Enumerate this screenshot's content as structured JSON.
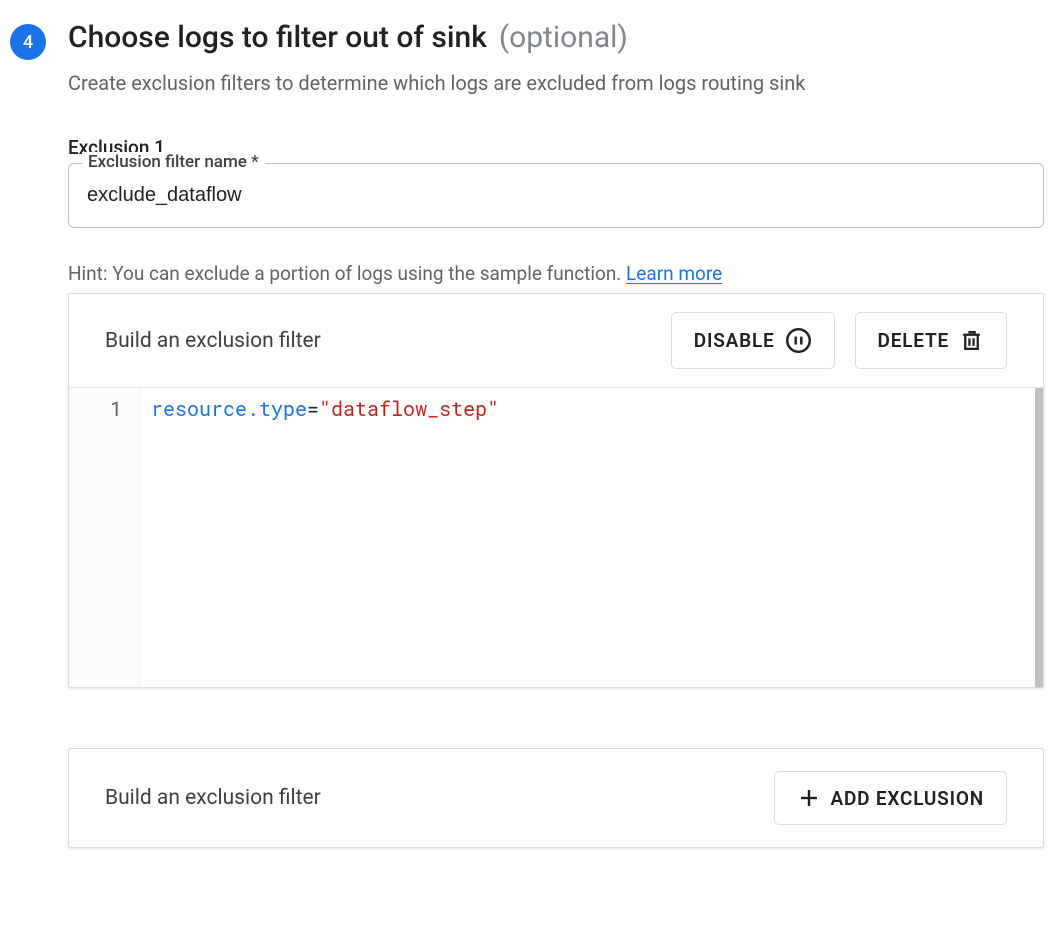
{
  "step": {
    "number": "4",
    "title": "Choose logs to filter out of sink",
    "optional_suffix": "(optional)",
    "subtitle": "Create exclusion filters to determine which logs are excluded from logs routing sink"
  },
  "exclusion": {
    "group_label": "Exclusion 1",
    "name_field_label": "Exclusion filter name *",
    "name_value": "exclude_dataflow"
  },
  "hint": {
    "text": "Hint: You can exclude a portion of logs using the sample function. ",
    "link_label": "Learn more"
  },
  "editor": {
    "panel_title": "Build an exclusion filter",
    "disable_label": "DISABLE",
    "delete_label": "DELETE",
    "line_number": "1",
    "code": {
      "ident": "resource.type",
      "op": "=",
      "string": "\"dataflow_step\""
    }
  },
  "add_row": {
    "title": "Build an exclusion filter",
    "button_label": "ADD EXCLUSION"
  }
}
